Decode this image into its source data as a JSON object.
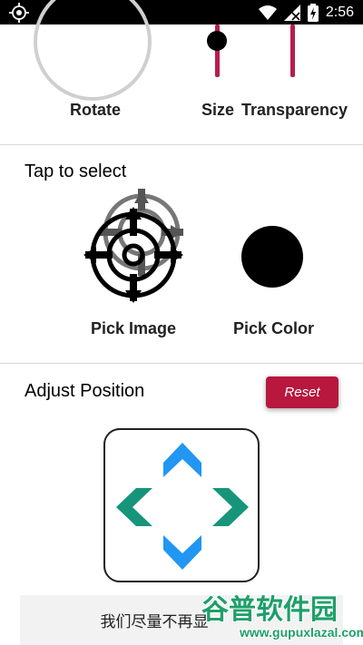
{
  "status_bar": {
    "time": "2:56",
    "icons": [
      "gps-icon",
      "wifi-icon",
      "signal-icon",
      "battery-charging-icon"
    ]
  },
  "controls": {
    "rotate_label": "Rotate",
    "size_label": "Size",
    "transparency_label": "Transparency"
  },
  "select_section": {
    "title": "Tap to select",
    "pick_image_label": "Pick Image",
    "pick_color_label": "Pick Color",
    "selected_color": "#000000"
  },
  "position_section": {
    "title": "Adjust Position",
    "reset_label": "Reset",
    "reset_color": "#b8173e",
    "arrow_colors": {
      "vertical": "#2196f3",
      "horizontal": "#16957a"
    }
  },
  "toast": {
    "text": "我们尽量不再显"
  },
  "watermark": {
    "title": "谷普软件园",
    "url": "www.gupuxlazal.com"
  }
}
